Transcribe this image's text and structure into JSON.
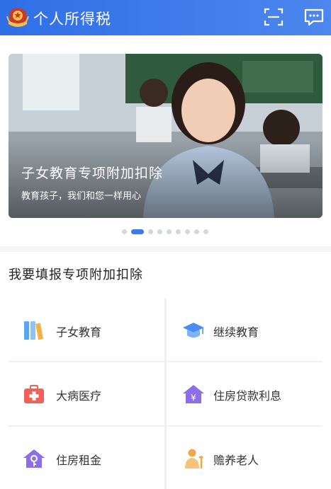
{
  "header": {
    "title": "个人所得税",
    "scan_icon": "scan-icon",
    "message_icon": "message-icon",
    "emblem_icon": "tax-emblem-icon",
    "bg_color": "#3a78e8"
  },
  "banner": {
    "title": "子女教育专项附加扣除",
    "subtitle": "教育孩子，我们和您一样用心",
    "slide_count": 9,
    "active_index": 1
  },
  "section": {
    "title": "我要填报专项附加扣除",
    "items": [
      {
        "label": "子女教育",
        "icon": "books-icon",
        "color": "#5aa6f0"
      },
      {
        "label": "继续教育",
        "icon": "graduation-cap-icon",
        "color": "#4a8ff0"
      },
      {
        "label": "大病医疗",
        "icon": "medical-kit-icon",
        "color": "#f0615a"
      },
      {
        "label": "住房贷款利息",
        "icon": "house-yen-icon",
        "color": "#8c6ee8"
      },
      {
        "label": "住房租金",
        "icon": "house-key-icon",
        "color": "#8c6ee8"
      },
      {
        "label": "赡养老人",
        "icon": "elderly-icon",
        "color": "#f3a64a"
      }
    ]
  }
}
